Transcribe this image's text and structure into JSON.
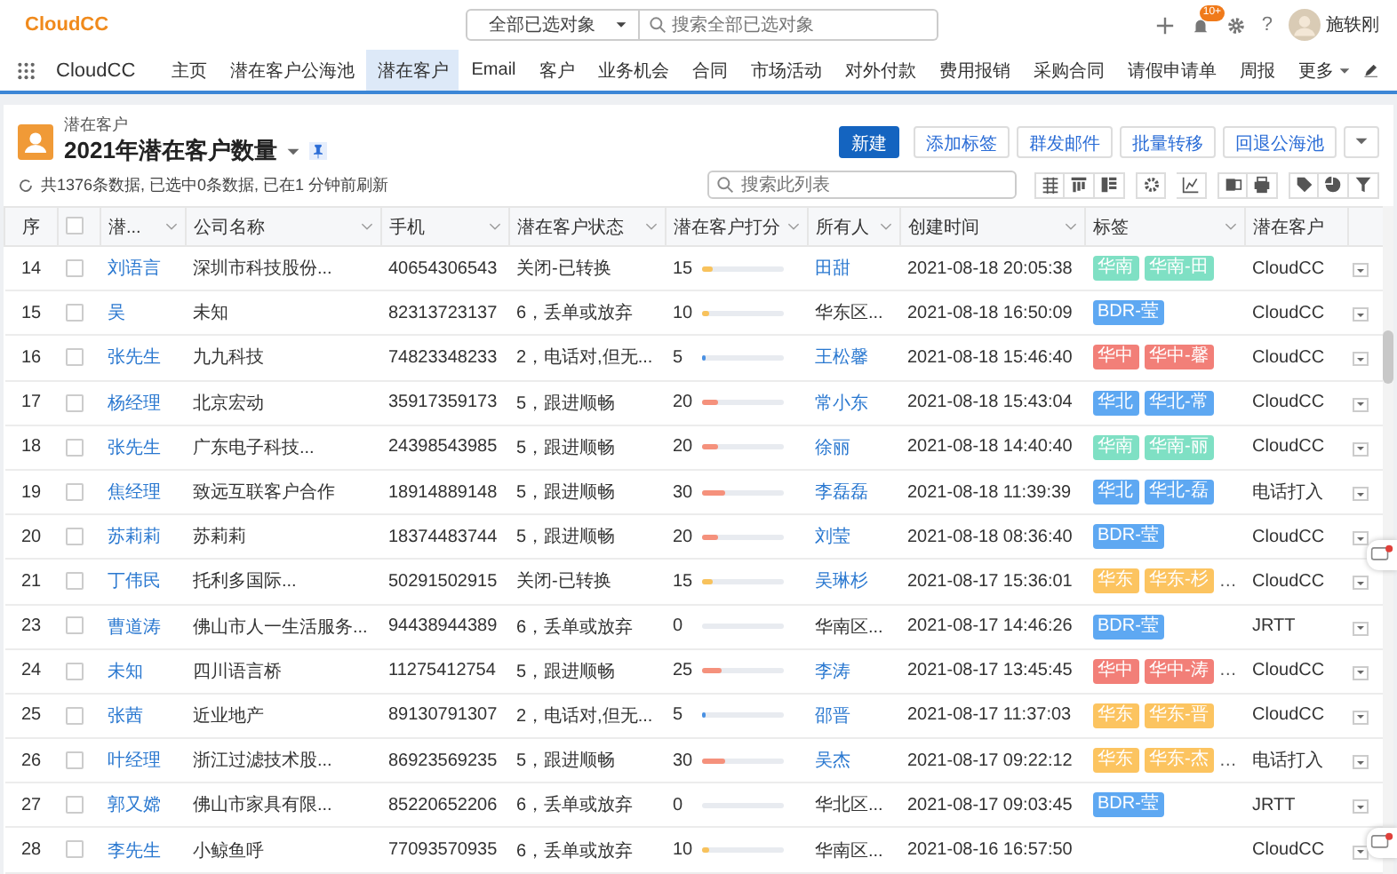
{
  "app": {
    "logo": "CloudCC",
    "scope_select": "全部已选对象",
    "search": {
      "placeholder": "搜索全部已选对象"
    },
    "notification_badge": "10+",
    "help": "?",
    "user": "施轶刚"
  },
  "nav": {
    "app_name": "CloudCC",
    "items": [
      {
        "label": "主页",
        "selected": false
      },
      {
        "label": "潜在客户公海池",
        "selected": false
      },
      {
        "label": "潜在客户",
        "selected": true
      },
      {
        "label": "Email",
        "selected": false
      },
      {
        "label": "客户",
        "selected": false
      },
      {
        "label": "业务机会",
        "selected": false
      },
      {
        "label": "合同",
        "selected": false
      },
      {
        "label": "市场活动",
        "selected": false
      },
      {
        "label": "对外付款",
        "selected": false
      },
      {
        "label": "费用报销",
        "selected": false
      },
      {
        "label": "采购合同",
        "selected": false
      },
      {
        "label": "请假申请单",
        "selected": false
      },
      {
        "label": "周报",
        "selected": false
      }
    ],
    "more": "更多"
  },
  "list_header": {
    "object": "潜在客户",
    "title": "2021年潜在客户数量",
    "status": "共1376条数据, 已选中0条数据, 已在1 分钟前刷新",
    "buttons": [
      {
        "label": "新建",
        "kind": "primary"
      },
      {
        "label": "添加标签",
        "kind": "plain"
      },
      {
        "label": "群发邮件",
        "kind": "plain"
      },
      {
        "label": "批量转移",
        "kind": "plain"
      },
      {
        "label": "回退公海池",
        "kind": "plain"
      }
    ],
    "search": {
      "placeholder": "搜索此列表"
    }
  },
  "table": {
    "columns": [
      "序",
      "潜...",
      "公司名称",
      "手机",
      "潜在客户状态",
      "潜在客户打分",
      "所有人",
      "创建时间",
      "标签",
      "潜在客户"
    ],
    "all_checked": false,
    "rows": [
      {
        "no": "14",
        "checked": false,
        "name": "刘语言",
        "company": "深圳市科技股份...",
        "phone": "40654306543",
        "status": "关闭-已转换",
        "score": "15",
        "level": 0.15,
        "owner": "田甜",
        "owner_link": true,
        "created": "2021-08-18 20:05:38",
        "tags": [
          {
            "text": "华南",
            "color": "#7fe0c4"
          },
          {
            "text": "华南-田",
            "color": "#7fe0c4"
          }
        ],
        "source": "CloudCC"
      },
      {
        "no": "15",
        "checked": false,
        "name": "吴",
        "company": "未知",
        "phone": "82313723137",
        "status": "6，丢单或放弃",
        "score": "10",
        "level": 0.1,
        "owner": "华东区...",
        "owner_link": false,
        "created": "2021-08-18 16:50:09",
        "tags": [
          {
            "text": "BDR-莹",
            "color": "#5ea8f2"
          }
        ],
        "source": "CloudCC"
      },
      {
        "no": "16",
        "checked": false,
        "name": "张先生",
        "company": "九九科技",
        "phone": "74823348233",
        "status": "2，电话对,但无...",
        "score": "5",
        "level": 0.05,
        "owner": "王松馨",
        "owner_link": true,
        "created": "2021-08-18 15:46:40",
        "tags": [
          {
            "text": "华中",
            "color": "#f27f78"
          },
          {
            "text": "华中-馨",
            "color": "#f27f78"
          }
        ],
        "source": "CloudCC"
      },
      {
        "no": "17",
        "checked": false,
        "name": "杨经理",
        "company": "北京宏动",
        "phone": "35917359173",
        "status": "5，跟进顺畅",
        "score": "20",
        "level": 0.2,
        "owner": "常小东",
        "owner_link": true,
        "created": "2021-08-18 15:43:04",
        "tags": [
          {
            "text": "华北",
            "color": "#5ea8f2"
          },
          {
            "text": "华北-常",
            "color": "#5ea8f2"
          }
        ],
        "source": "CloudCC"
      },
      {
        "no": "18",
        "checked": false,
        "name": "张先生",
        "company": "广东电子科技...",
        "phone": "24398543985",
        "status": "5，跟进顺畅",
        "score": "20",
        "level": 0.2,
        "owner": "徐丽",
        "owner_link": true,
        "created": "2021-08-18 14:40:40",
        "tags": [
          {
            "text": "华南",
            "color": "#7fe0c4"
          },
          {
            "text": "华南-丽",
            "color": "#7fe0c4"
          }
        ],
        "source": "CloudCC"
      },
      {
        "no": "19",
        "checked": false,
        "name": "焦经理",
        "company": "致远互联客户合作",
        "phone": "18914889148",
        "status": "5，跟进顺畅",
        "score": "30",
        "level": 0.3,
        "owner": "李磊磊",
        "owner_link": true,
        "created": "2021-08-18 11:39:39",
        "tags": [
          {
            "text": "华北",
            "color": "#5ea8f2"
          },
          {
            "text": "华北-磊",
            "color": "#5ea8f2"
          }
        ],
        "source": "电话打入"
      },
      {
        "no": "20",
        "checked": false,
        "name": "苏莉莉",
        "company": "苏莉莉",
        "phone": "18374483744",
        "status": "5，跟进顺畅",
        "score": "20",
        "level": 0.2,
        "owner": "刘莹",
        "owner_link": true,
        "created": "2021-08-18 08:36:40",
        "tags": [
          {
            "text": "BDR-莹",
            "color": "#5ea8f2"
          }
        ],
        "source": "CloudCC"
      },
      {
        "no": "21",
        "checked": false,
        "name": "丁伟民",
        "company": "托利多国际...",
        "phone": "50291502915",
        "status": "关闭-已转换",
        "score": "15",
        "level": 0.15,
        "owner": "吴琳杉",
        "owner_link": true,
        "created": "2021-08-17 15:36:01",
        "tags": [
          {
            "text": "华东",
            "color": "#fcc460"
          },
          {
            "text": "华东-杉",
            "color": "#fcc460"
          }
        ],
        "tags_more": "…",
        "source": "CloudCC"
      },
      {
        "no": "23",
        "checked": false,
        "name": "曹道涛",
        "company": "佛山市人一生活服务...",
        "phone": "94438944389",
        "status": "6，丢单或放弃",
        "score": "0",
        "level": 0,
        "owner": "华南区...",
        "owner_link": false,
        "created": "2021-08-17 14:46:26",
        "tags": [
          {
            "text": "BDR-莹",
            "color": "#5ea8f2"
          }
        ],
        "source": "JRTT"
      },
      {
        "no": "24",
        "checked": false,
        "name": "未知",
        "company": "四川语言桥",
        "phone": "11275412754",
        "status": "5，跟进顺畅",
        "score": "25",
        "level": 0.25,
        "owner": "李涛",
        "owner_link": true,
        "created": "2021-08-17 13:45:45",
        "tags": [
          {
            "text": "华中",
            "color": "#f27f78"
          },
          {
            "text": "华中-涛",
            "color": "#f27f78"
          }
        ],
        "tags_more": "…",
        "source": "CloudCC"
      },
      {
        "no": "25",
        "checked": false,
        "name": "张茜",
        "company": "近业地产",
        "phone": "89130791307",
        "status": "2，电话对,但无...",
        "score": "5",
        "level": 0.05,
        "owner": "邵晋",
        "owner_link": true,
        "created": "2021-08-17 11:37:03",
        "tags": [
          {
            "text": "华东",
            "color": "#fcc460"
          },
          {
            "text": "华东-晋",
            "color": "#fcc460"
          }
        ],
        "source": "CloudCC"
      },
      {
        "no": "26",
        "checked": false,
        "name": "叶经理",
        "company": "浙江过滤技术股...",
        "phone": "86923569235",
        "status": "5，跟进顺畅",
        "score": "30",
        "level": 0.3,
        "owner": "吴杰",
        "owner_link": true,
        "created": "2021-08-17 09:22:12",
        "tags": [
          {
            "text": "华东",
            "color": "#fcc460"
          },
          {
            "text": "华东-杰",
            "color": "#fcc460"
          }
        ],
        "tags_more": "…",
        "source": "电话打入"
      },
      {
        "no": "27",
        "checked": false,
        "name": "郭又嫦",
        "company": "佛山市家具有限...",
        "phone": "85220652206",
        "status": "6，丢单或放弃",
        "score": "0",
        "level": 0,
        "owner": "华北区...",
        "owner_link": false,
        "created": "2021-08-17 09:03:45",
        "tags": [
          {
            "text": "BDR-莹",
            "color": "#5ea8f2"
          }
        ],
        "source": "JRTT"
      },
      {
        "no": "28",
        "checked": false,
        "name": "李先生",
        "company": "小鲸鱼呼",
        "phone": "77093570935",
        "status": "6，丢单或放弃",
        "score": "10",
        "level": 0.1,
        "owner": "华南区...",
        "owner_link": false,
        "created": "2021-08-16 16:57:50",
        "tags": [],
        "source": "CloudCC"
      }
    ]
  }
}
